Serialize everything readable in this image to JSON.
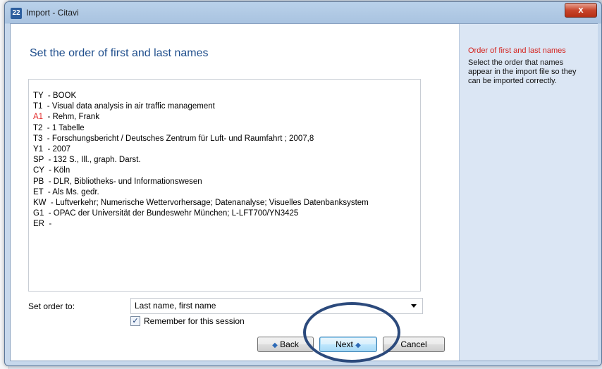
{
  "window": {
    "title": "Import - Citavi",
    "icon_label": "22",
    "close_label": "x"
  },
  "main": {
    "heading": "Set the order of first and last names",
    "preview_lines": [
      {
        "tag": "TY",
        "text": "  - BOOK"
      },
      {
        "tag": "T1",
        "text": "  - Visual data analysis in air traffic management"
      },
      {
        "tag": "A1",
        "text": "  - Rehm, Frank"
      },
      {
        "tag": "T2",
        "text": "  - 1 Tabelle"
      },
      {
        "tag": "T3",
        "text": "  - Forschungsbericht / Deutsches Zentrum für Luft- und Raumfahrt ; 2007,8"
      },
      {
        "tag": "Y1",
        "text": "  - 2007"
      },
      {
        "tag": "SP",
        "text": "  - 132 S., Ill., graph. Darst."
      },
      {
        "tag": "CY",
        "text": "  - Köln"
      },
      {
        "tag": "PB",
        "text": "  - DLR, Bibliotheks- und Informationswesen"
      },
      {
        "tag": "ET",
        "text": "  - Als Ms. gedr."
      },
      {
        "tag": "KW",
        "text": "  - Luftverkehr; Numerische Wettervorhersage; Datenanalyse; Visuelles Datenbanksystem"
      },
      {
        "tag": "G1",
        "text": "  - OPAC der Universität der Bundeswehr München; L-LFT700/YN3425"
      },
      {
        "tag": "ER",
        "text": "  -"
      }
    ],
    "order_label": "Set order to:",
    "order_value": "Last name, first name",
    "remember_label": "Remember for this session",
    "remember_checked": "✓"
  },
  "buttons": {
    "back": "Back",
    "next": "Next",
    "cancel": "Cancel",
    "back_icon": "◆",
    "next_icon": "◆"
  },
  "side": {
    "title": "Order of first and last names",
    "text": "Select the order that names appear in the import file so they can be imported correctly."
  },
  "colors": {
    "heading": "#1f4e8c",
    "highlight_tag": "#e32b2b",
    "side_panel": "#dbe6f4"
  }
}
